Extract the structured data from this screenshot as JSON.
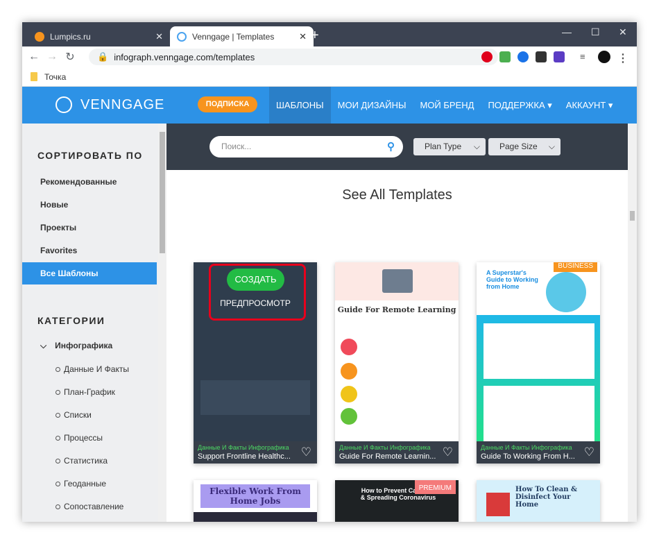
{
  "browser": {
    "tabs": [
      {
        "label": "Lumpics.ru"
      },
      {
        "label": "Venngage | Templates"
      }
    ],
    "url": "infograph.venngage.com/templates",
    "bookmark": "Точка"
  },
  "header": {
    "logo": "VENNGAGE",
    "subscribe": "ПОДПИСКА",
    "menu": [
      "ШАБЛОНЫ",
      "МОИ ДИЗАЙНЫ",
      "МОЙ БРЕНД",
      "ПОДДЕРЖКА ▾",
      "АККАУНТ ▾"
    ]
  },
  "sidebar": {
    "sort_title": "СОРТИРОВАТЬ ПО",
    "sort_items": [
      "Рекомендованные",
      "Новые",
      "Проекты",
      "Favorites",
      "Все Шаблоны"
    ],
    "cat_title": "КАТЕГОРИИ",
    "cat_group": "Инфографика",
    "categories": [
      "Данные И Факты",
      "План-График",
      "Списки",
      "Процессы",
      "Статистика",
      "Геоданные",
      "Сопоставление"
    ]
  },
  "main": {
    "search_placeholder": "Поиск...",
    "filters": [
      "Plan Type",
      "Page Size"
    ],
    "title": "See All Templates",
    "hover": {
      "create": "СОЗДАТЬ",
      "preview": "ПРЕДПРОСМОТР"
    },
    "cards": [
      {
        "category": "Данные И Факты Инфографика",
        "title": "Support Frontline Healthc...",
        "badge": ""
      },
      {
        "category": "Данные И Факты Инфографика",
        "title": "Guide For Remote Learnin...",
        "badge": "",
        "thumb_title": "Guide For Remote Learning"
      },
      {
        "category": "Данные И Факты Инфографика",
        "title": "Guide To Working From H...",
        "badge": "BUSINESS",
        "thumb_title": "A Superstar's Guide to Working from Home"
      },
      {
        "thumb_title": "Flexible Work From Home Jobs",
        "badge": ""
      },
      {
        "thumb_title": "How to Prevent Catching & Spreading Coronavirus",
        "badge": "PREMIUM"
      },
      {
        "thumb_title": "How To Clean & Disinfect Your Home",
        "badge": ""
      }
    ]
  },
  "colors": {
    "brand": "#2d92e6",
    "subscribe": "#f7941e",
    "create": "#22bb44",
    "highlight": "#e8001c"
  }
}
